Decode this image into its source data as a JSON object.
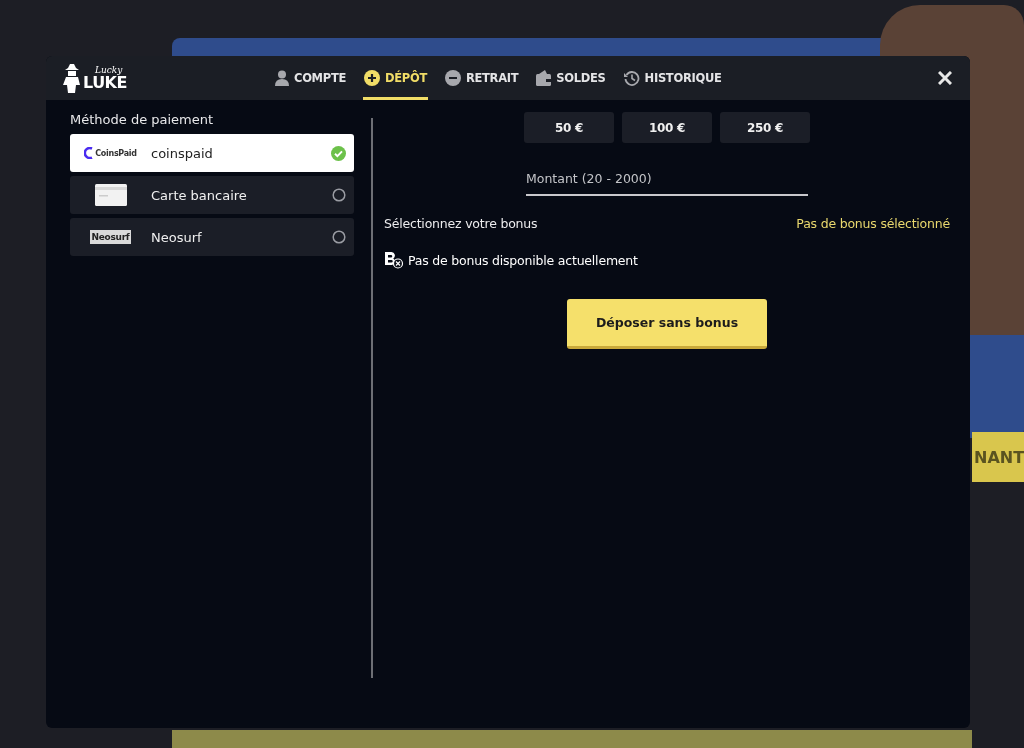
{
  "logo": {
    "line1": "Lucky",
    "line2": "LUKE"
  },
  "tabs": [
    {
      "label": "COMPTE",
      "kind": "account",
      "selected": false
    },
    {
      "label": "DÉPÔT",
      "kind": "deposit",
      "selected": true
    },
    {
      "label": "RETRAIT",
      "kind": "withdraw",
      "selected": false
    },
    {
      "label": "SOLDES",
      "kind": "balance",
      "selected": false
    },
    {
      "label": "HISTORIQUE",
      "kind": "history",
      "selected": false
    }
  ],
  "payment": {
    "title": "Méthode de paiement",
    "methods": [
      {
        "kind": "coinspaid",
        "logo_text": "CoinsPaid",
        "name": "coinspaid",
        "selected": true
      },
      {
        "kind": "card",
        "name": "Carte bancaire",
        "selected": false
      },
      {
        "kind": "neosurf",
        "logo_text": "Neosurf",
        "name": "Neosurf",
        "selected": false
      }
    ]
  },
  "amounts": [
    "50 €",
    "100 €",
    "250 €"
  ],
  "amount_field": {
    "placeholder": "Montant (20 - 2000)"
  },
  "bonus": {
    "label": "Sélectionnez votre bonus",
    "status": "Pas de bonus sélectionné",
    "notice": "Pas de bonus disponible actuellement"
  },
  "submit": "Déposer sans bonus",
  "background": {
    "banner_button": "NANT"
  }
}
